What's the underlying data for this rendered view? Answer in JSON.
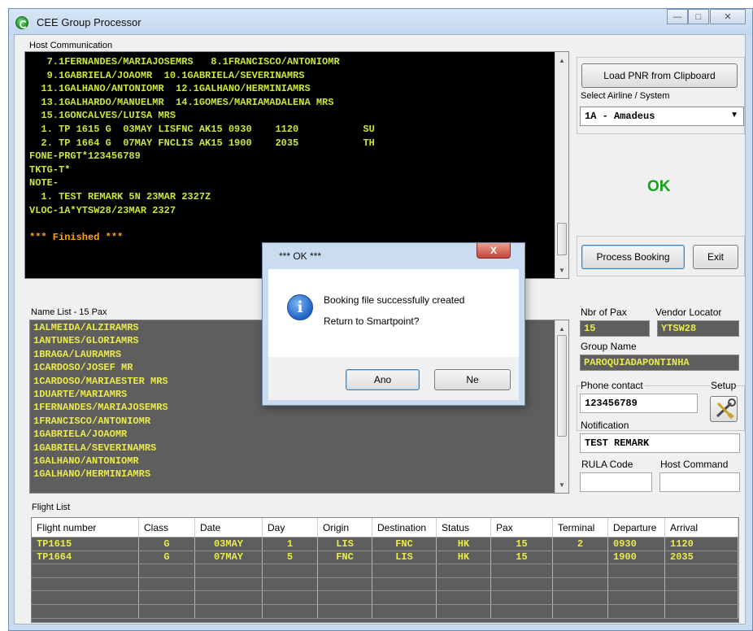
{
  "window": {
    "title": "CEE Group Processor",
    "buttons": {
      "minimize": "—",
      "maximize": "□",
      "close": "✕"
    }
  },
  "host_communication": {
    "label": "Host Communication",
    "lines": [
      "   7.1FERNANDES/MARIAJOSEMRS   8.1FRANCISCO/ANTONIOMR",
      "   9.1GABRIELA/JOAOMR  10.1GABRIELA/SEVERINAMRS",
      "  11.1GALHANO/ANTONIOMR  12.1GALHANO/HERMINIAMRS",
      "  13.1GALHARDO/MANUELMR  14.1GOMES/MARIAMADALENA MRS",
      "  15.1GONCALVES/LUISA MRS",
      "  1. TP 1615 G  03MAY LISFNC AK15 0930    1120           SU",
      "  2. TP 1664 G  07MAY FNCLIS AK15 1900    2035           TH",
      "FONE-PRGT*123456789",
      "TKTG-T*",
      "NOTE-",
      "  1. TEST REMARK 5N 23MAR 2327Z",
      "VLOC-1A*YTSW28/23MAR 2327",
      "",
      "*** Finished ***"
    ]
  },
  "controls": {
    "load_pnr": "Load PNR from Clipboard",
    "select_airline_label": "Select Airline / System",
    "airline_value": "1A  -  Amadeus",
    "status": "OK",
    "process_booking": "Process Booking",
    "exit": "Exit"
  },
  "name_list": {
    "label": "Name List - 15 Pax",
    "names": [
      "1ALMEIDA/ALZIRAMRS",
      "1ANTUNES/GLORIAMRS",
      "1BRAGA/LAURAMRS",
      "1CARDOSO/JOSEF MR",
      "1CARDOSO/MARIAESTER MRS",
      "1DUARTE/MARIAMRS",
      "1FERNANDES/MARIAJOSEMRS",
      "1FRANCISCO/ANTONIOMR",
      "1GABRIELA/JOAOMR",
      "1GABRIELA/SEVERINAMRS",
      "1GALHANO/ANTONIOMR",
      "1GALHANO/HERMINIAMRS"
    ]
  },
  "details": {
    "nbr_pax_label": "Nbr of Pax",
    "nbr_pax": "15",
    "vendor_locator_label": "Vendor Locator",
    "vendor_locator": "YTSW28",
    "group_name_label": "Group Name",
    "group_name": "PAROQUIADAPONTINHA",
    "phone_label": "Phone contact",
    "phone": "123456789",
    "setup_label": "Setup",
    "notification_label": "Notification",
    "notification": "TEST REMARK",
    "rula_label": "RULA Code",
    "rula": "",
    "host_command_label": "Host Command",
    "host_command": ""
  },
  "flight_list": {
    "label": "Flight List",
    "columns": [
      "Flight number",
      "Class",
      "Date",
      "Day",
      "Origin",
      "Destination",
      "Status",
      "Pax",
      "Terminal",
      "Departure",
      "Arrival"
    ],
    "rows": [
      [
        "TP1615",
        "G",
        "03MAY",
        "1",
        "LIS",
        "FNC",
        "HK",
        "15",
        "2",
        "0930",
        "1120"
      ],
      [
        "TP1664",
        "G",
        "07MAY",
        "5",
        "FNC",
        "LIS",
        "HK",
        "15",
        "",
        "1900",
        "2035"
      ],
      [
        "",
        "",
        "",
        "",
        "",
        "",
        "",
        "",
        "",
        "",
        ""
      ],
      [
        "",
        "",
        "",
        "",
        "",
        "",
        "",
        "",
        "",
        "",
        ""
      ],
      [
        "",
        "",
        "",
        "",
        "",
        "",
        "",
        "",
        "",
        "",
        ""
      ],
      [
        "",
        "",
        "",
        "",
        "",
        "",
        "",
        "",
        "",
        "",
        ""
      ]
    ]
  },
  "dialog": {
    "title": "*** OK ***",
    "close": "X",
    "message1": "Booking file successfully created",
    "message2": "Return to Smartpoint?",
    "yes": "Ano",
    "no": "Ne",
    "icon": "info-icon"
  }
}
